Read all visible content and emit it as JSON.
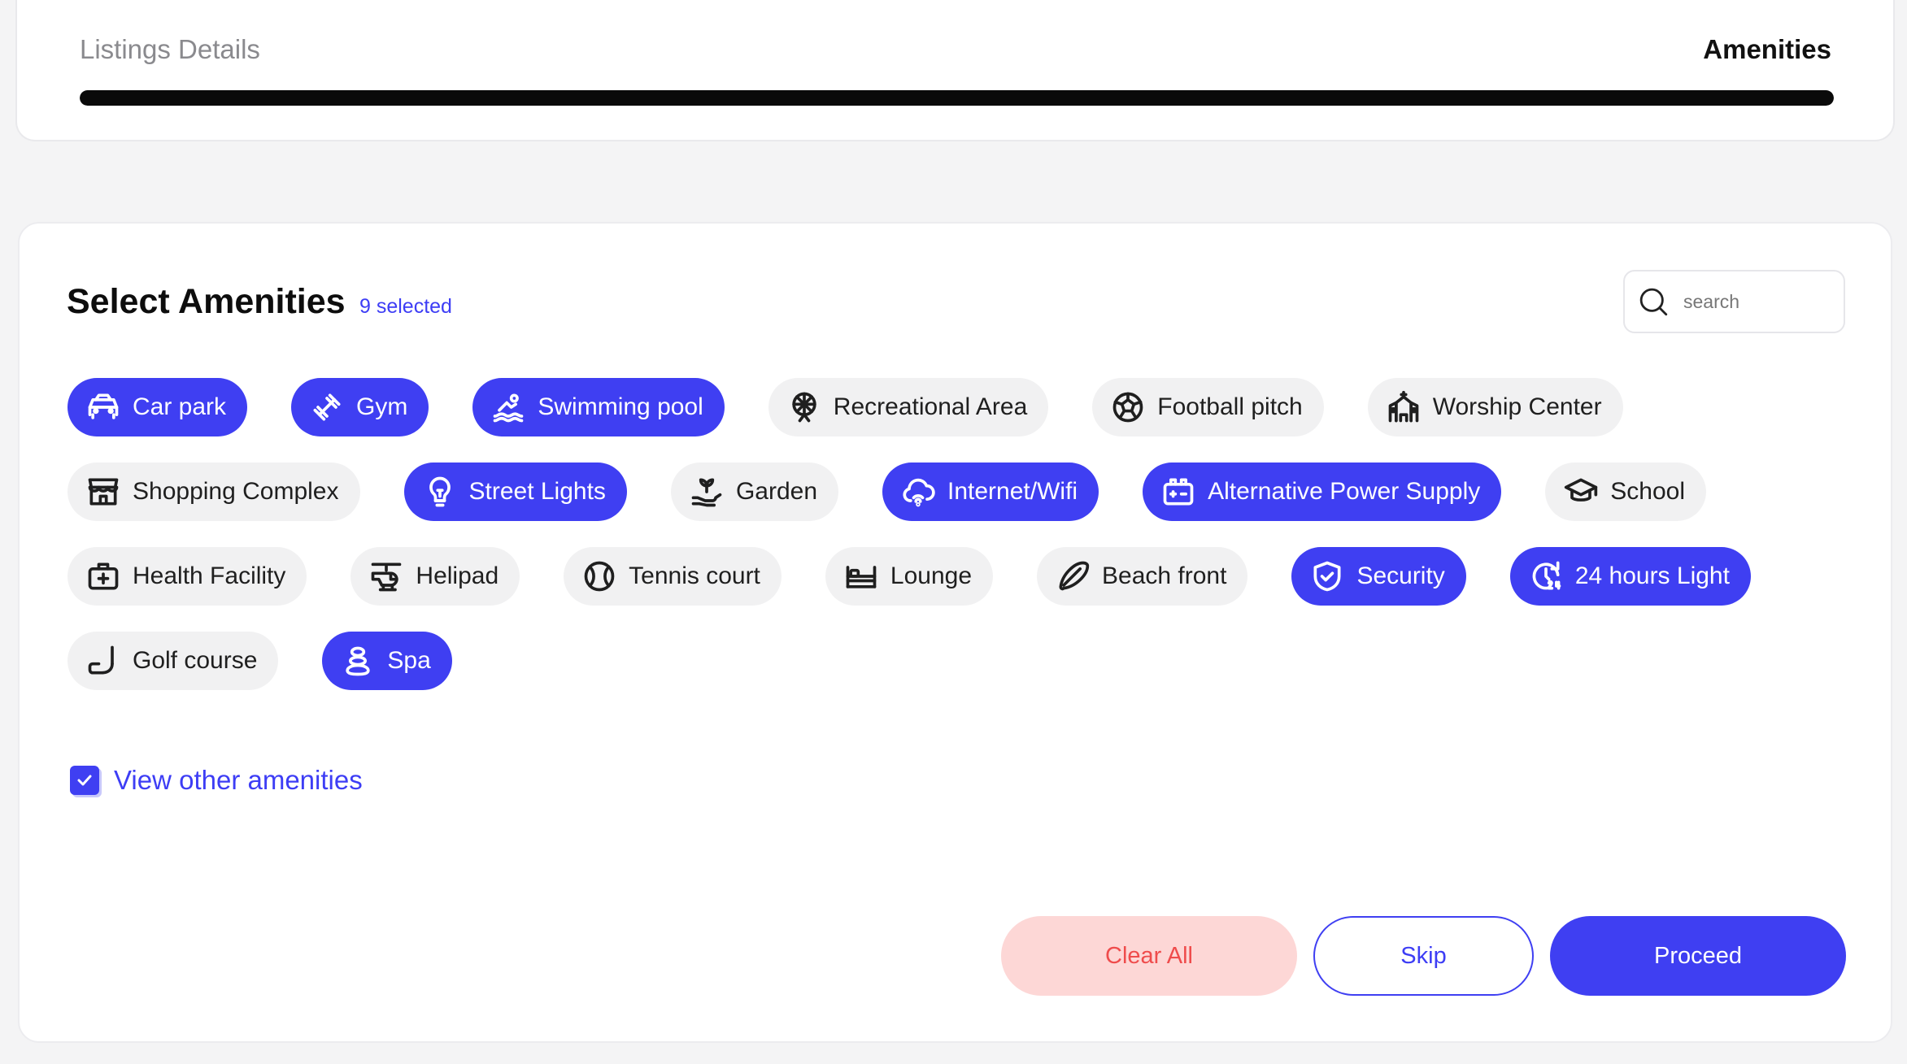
{
  "stepper": {
    "left_label": "Listings Details",
    "right_label": "Amenities",
    "progress": 1.0
  },
  "amenities": {
    "title": "Select Amenities",
    "count_text": "9 selected",
    "search_placeholder": "search",
    "rows": [
      [
        {
          "label": "Car park",
          "icon": "car-icon",
          "selected": true
        },
        {
          "label": "Gym",
          "icon": "dumbbell-icon",
          "selected": true
        },
        {
          "label": "Swimming pool",
          "icon": "swimmer-icon",
          "selected": true
        },
        {
          "label": "Recreational Area",
          "icon": "ferris-wheel-icon",
          "selected": false
        },
        {
          "label": "Football pitch",
          "icon": "football-icon",
          "selected": false
        },
        {
          "label": "Worship Center",
          "icon": "church-icon",
          "selected": false
        }
      ],
      [
        {
          "label": "Shopping Complex",
          "icon": "store-icon",
          "selected": false
        },
        {
          "label": "Street Lights",
          "icon": "bulb-icon",
          "selected": true
        },
        {
          "label": "Garden",
          "icon": "plant-hand-icon",
          "selected": false
        },
        {
          "label": "Internet/Wifi",
          "icon": "wifi-cloud-icon",
          "selected": true
        },
        {
          "label": "Alternative Power Supply",
          "icon": "battery-icon",
          "selected": true
        },
        {
          "label": "School",
          "icon": "graduation-cap-icon",
          "selected": false
        }
      ],
      [
        {
          "label": "Health Facility",
          "icon": "medical-bag-icon",
          "selected": false
        },
        {
          "label": "Helipad",
          "icon": "helicopter-icon",
          "selected": false
        },
        {
          "label": "Tennis court",
          "icon": "tennis-ball-icon",
          "selected": false
        },
        {
          "label": "Lounge",
          "icon": "bed-icon",
          "selected": false
        },
        {
          "label": "Beach front",
          "icon": "surfboard-icon",
          "selected": false
        },
        {
          "label": "Security",
          "icon": "shield-check-icon",
          "selected": true
        },
        {
          "label": "24 hours Light",
          "icon": "clock-24-icon",
          "selected": true
        }
      ],
      [
        {
          "label": "Golf course",
          "icon": "golf-club-icon",
          "selected": false
        },
        {
          "label": "Spa",
          "icon": "spa-stones-icon",
          "selected": true
        }
      ]
    ],
    "view_other_label": "View other amenities",
    "view_other_checked": true
  },
  "actions": {
    "clear_label": "Clear All",
    "skip_label": "Skip",
    "proceed_label": "Proceed"
  },
  "colors": {
    "accent": "#3f3ff2",
    "clear_bg": "#fdd7d6",
    "clear_text": "#ef4c4c",
    "chip_bg": "#f1f1f2"
  }
}
